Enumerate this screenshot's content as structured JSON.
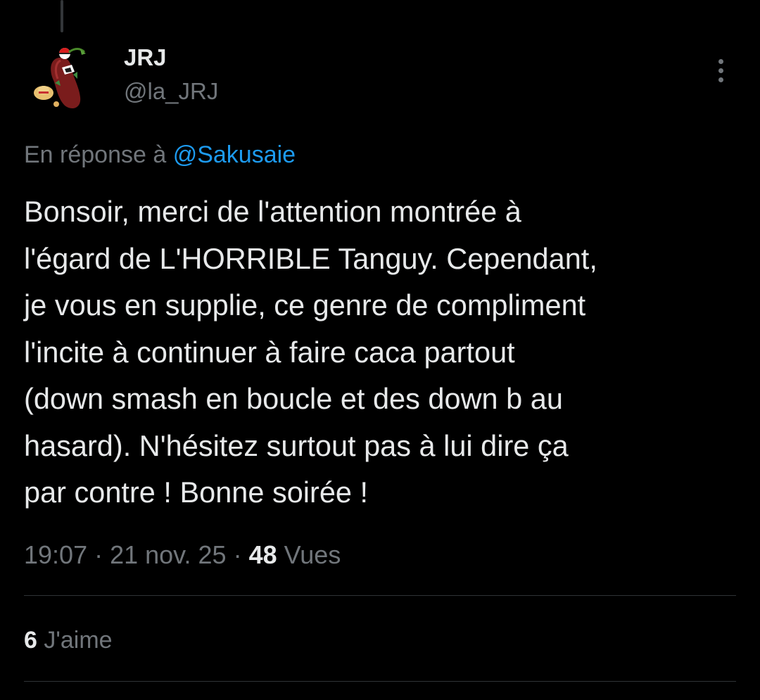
{
  "tweet": {
    "author": {
      "display_name": "JRJ",
      "handle": "@la_JRJ",
      "avatar_icon": "eggplant-character-avatar"
    },
    "more_icon": "more-vertical-icon",
    "reply_context": {
      "prefix": "En réponse à ",
      "mention": "@Sakusaie"
    },
    "text_lines": [
      "Bonsoir, merci de l'attention montrée à",
      "l'égard de L'HORRIBLE Tanguy. Cependant,",
      "je vous en supplie, ce genre de compliment",
      "l'incite à continuer à faire caca partout",
      "(down smash en boucle et des down b au",
      "hasard). N'hésitez surtout pas à lui dire ça",
      "par contre ! Bonne soirée !"
    ],
    "meta": {
      "time": "19:07",
      "separator": " · ",
      "date": "21 nov. 25",
      "views_count": "48",
      "views_label": " Vues"
    },
    "stats": {
      "likes_count": "6",
      "likes_label": " J'aime"
    }
  },
  "colors": {
    "background": "#000000",
    "text_primary": "#e7e9ea",
    "text_secondary": "#71767b",
    "accent": "#1d9bf0",
    "divider": "#2f3336"
  }
}
